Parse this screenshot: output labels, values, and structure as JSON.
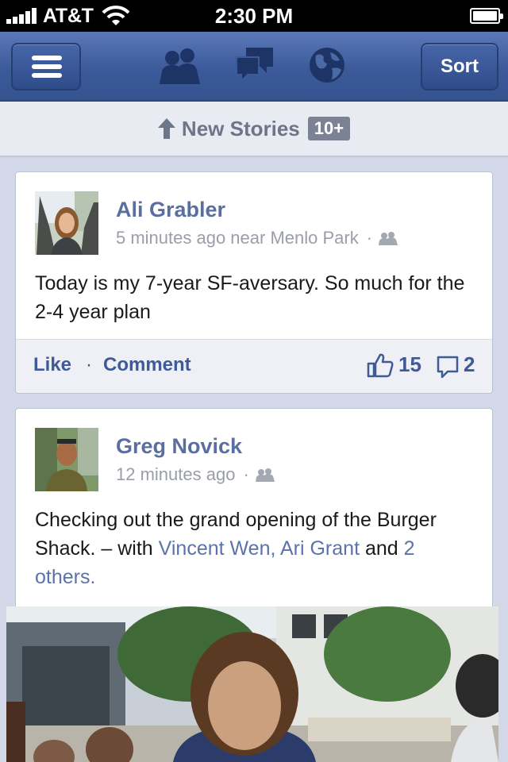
{
  "status_bar": {
    "carrier": "AT&T",
    "time": "2:30 PM"
  },
  "nav": {
    "sort_label": "Sort",
    "icons": [
      "menu-icon",
      "friend-requests-icon",
      "messages-icon",
      "notifications-globe-icon"
    ]
  },
  "new_stories": {
    "label": "New Stories",
    "badge": "10+"
  },
  "stories": [
    {
      "author": "Ali Grabler",
      "meta": "5 minutes ago near Menlo Park",
      "text": "Today is my 7-year SF-aversary. So much for the 2-4 year plan",
      "like_label": "Like",
      "comment_label": "Comment",
      "likes": "15",
      "comments": "2"
    },
    {
      "author": "Greg Novick",
      "meta": "12 minutes ago",
      "text_before": "Checking out the grand opening of the Burger Shack. – with ",
      "tagged": "Vincent Wen, Ari Grant",
      "and": " and ",
      "others": "2 others",
      "period": "."
    }
  ],
  "colors": {
    "nav_blue": "#3b5a9a",
    "link_blue": "#3f5a95",
    "background": "#d3d8e8"
  }
}
